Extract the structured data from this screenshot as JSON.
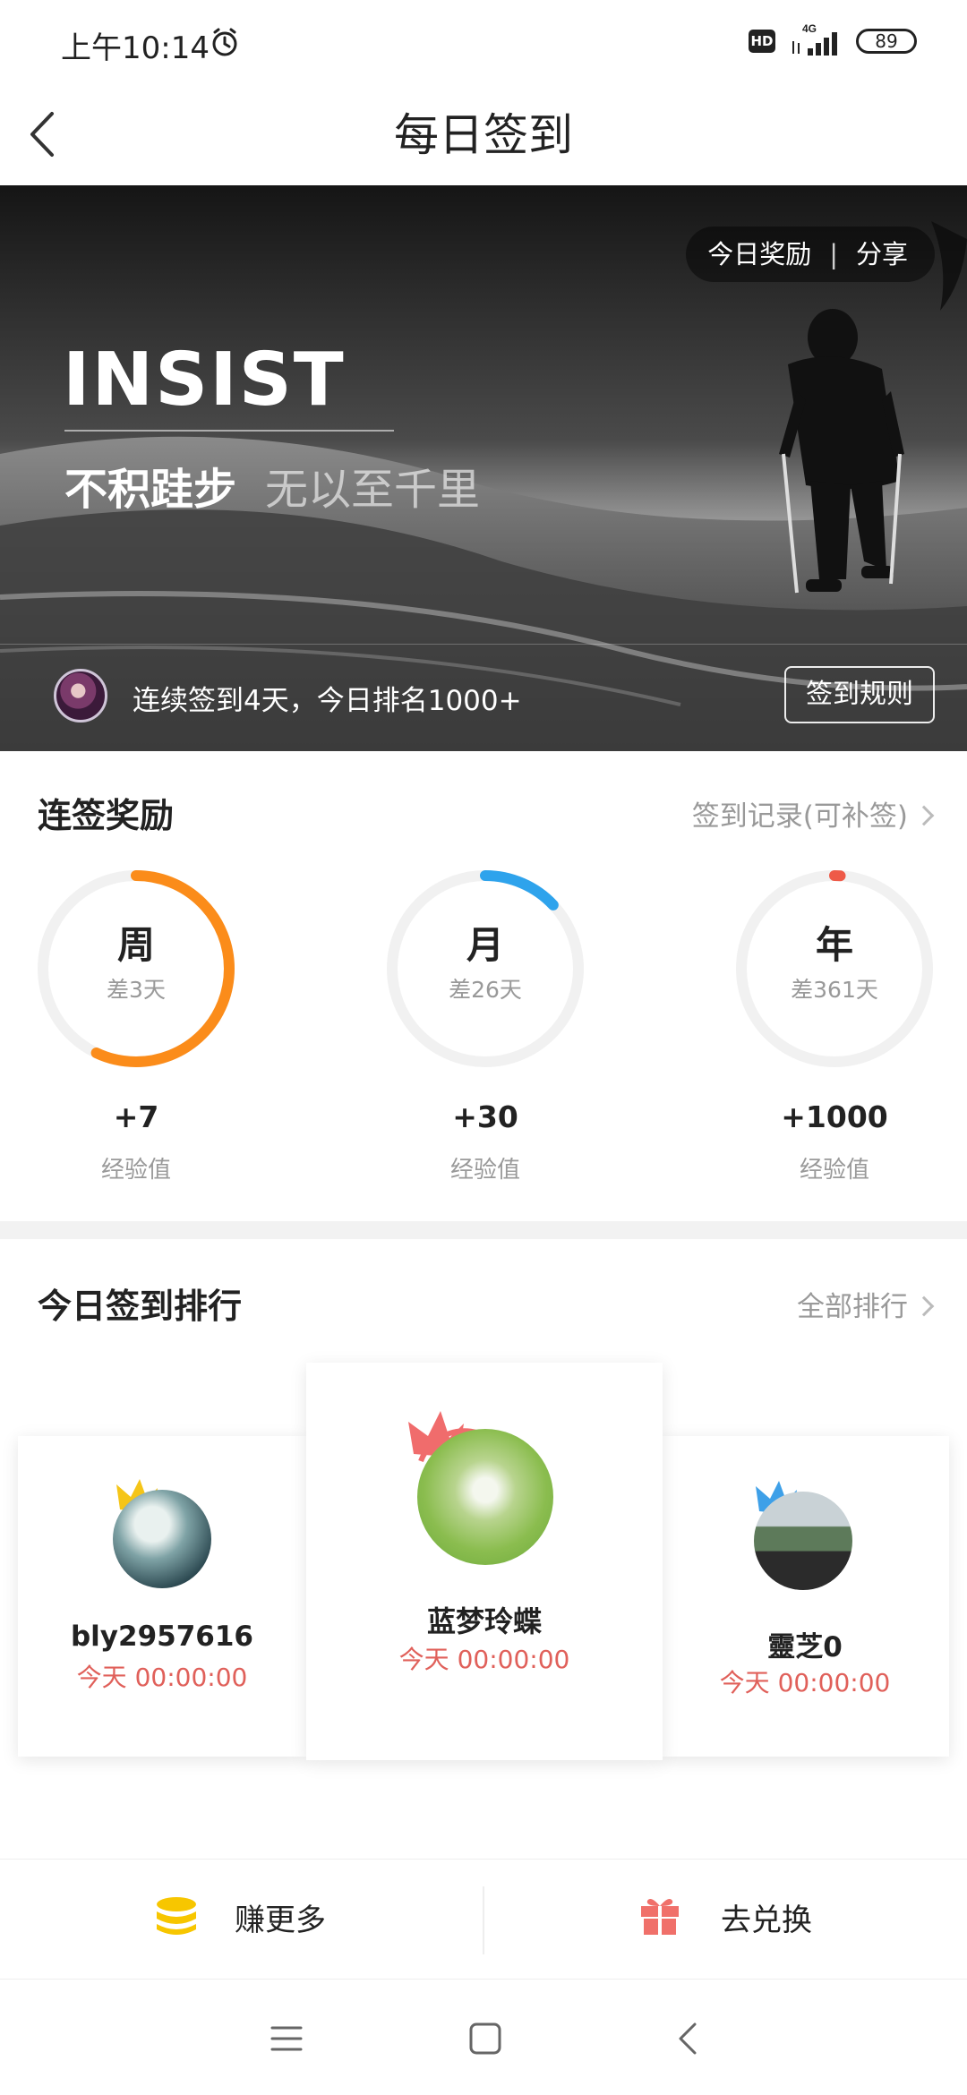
{
  "status_bar": {
    "time": "上午10:14",
    "hd": "HD",
    "battery": "89"
  },
  "nav": {
    "title": "每日签到"
  },
  "banner": {
    "today_reward": "今日奖励",
    "separator": "|",
    "share": "分享",
    "headline": "INSIST",
    "motto_main": "不积跬步",
    "motto_sub": "无以至千里",
    "streak_text": "连续签到4天，今日排名1000+",
    "rules_button": "签到规则"
  },
  "streak_rewards": {
    "title": "连签奖励",
    "record_link": "签到记录(可补签)",
    "items": [
      {
        "period": "周",
        "remaining": "差3天",
        "reward": "+7",
        "unit": "经验值",
        "progress": 0.57,
        "color": "#fb8c1a"
      },
      {
        "period": "月",
        "remaining": "差26天",
        "reward": "+30",
        "unit": "经验值",
        "progress": 0.13,
        "color": "#2ea3ec"
      },
      {
        "period": "年",
        "remaining": "差361天",
        "reward": "+1000",
        "unit": "经验值",
        "progress": 0.01,
        "color": "#ee5a48"
      }
    ]
  },
  "ranking": {
    "title": "今日签到排行",
    "all_link": "全部排行",
    "first": {
      "name": "蓝梦玲蝶",
      "time": "今天 00:00:00",
      "crown_color": "#f06c6c"
    },
    "second": {
      "name": "bly2957616",
      "time": "今天 00:00:00",
      "crown_color": "#f5c518"
    },
    "third": {
      "name": "靈芝0",
      "time": "今天 00:00:00",
      "crown_color": "#3ea0e8"
    }
  },
  "actions": {
    "earn_more": "赚更多",
    "exchange": "去兑换"
  },
  "colors": {
    "accent_red": "#e0605a",
    "coin": "#f7c600",
    "gift": "#f0706a"
  }
}
